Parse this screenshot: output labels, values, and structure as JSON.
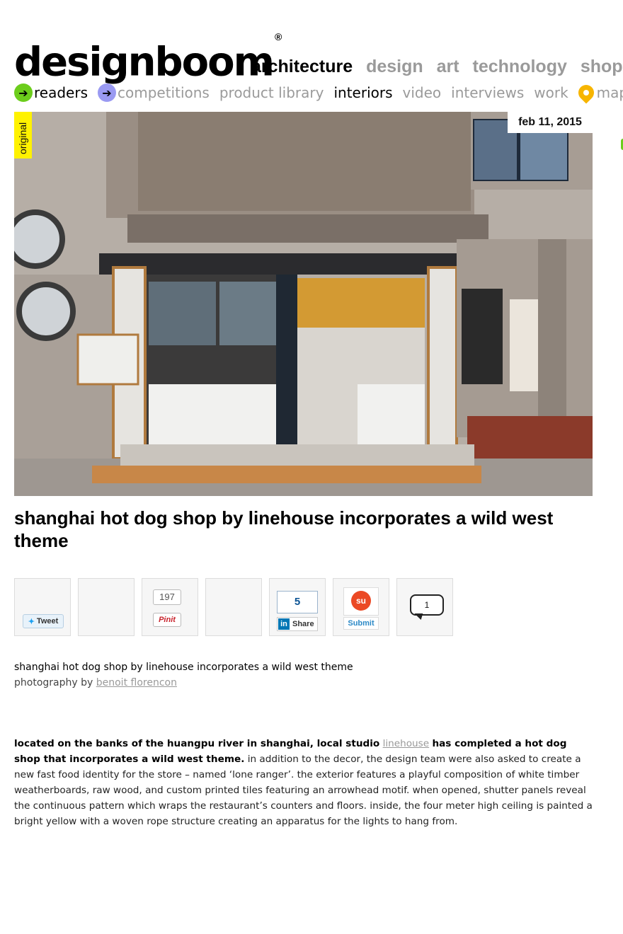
{
  "site": {
    "logo_text": "designboom",
    "logo_mark": "®"
  },
  "top_nav": [
    "architecture",
    "design",
    "art",
    "technology",
    "shop"
  ],
  "top_nav_active": "architecture",
  "sub_nav": {
    "readers": "readers",
    "competitions": "competitions",
    "product_library": "product library",
    "interiors": "interiors",
    "video": "video",
    "interviews": "interviews",
    "work": "work",
    "maps": "maps"
  },
  "hero": {
    "badge": "original",
    "date": "feb 11, 2015"
  },
  "article": {
    "title": "shanghai hot dog shop by linehouse incorporates a wild west theme",
    "caption_title": "shanghai hot dog shop by linehouse incorporates a wild west theme",
    "photo_prefix": "photography by",
    "photographer": "benoit florencon",
    "p1_lead": "located on the banks of the huangpu river in shanghai, local studio",
    "p1_studio": "linehouse",
    "p1_lead2": "has completed a hot dog shop that incorporates a wild west theme.",
    "p1_rest": "in addition to the decor, the design team were also asked to create a new fast food identity for the store – named ‘lone ranger’. the exterior features a playful composition of white timber weatherboards, raw wood, and custom printed tiles featuring an arrowhead motif. when opened, shutter panels reveal the continuous pattern which wraps the restaurant’s counters and floors. inside, the four meter high ceiling is painted a bright yellow with a woven rope structure creating an apparatus for the lights to hang from."
  },
  "share": {
    "tweet_label": "Tweet",
    "pin_count": "197",
    "pin_label": "Pinit",
    "linkedin_count": "5",
    "linkedin_label": "Share",
    "stumble_label": "Submit",
    "comments_count": "1"
  },
  "colors": {
    "accent_green": "#6ccd1c",
    "accent_purple": "#9a9af2",
    "map_pin": "#f7b500",
    "badge_yellow": "#fff200"
  }
}
